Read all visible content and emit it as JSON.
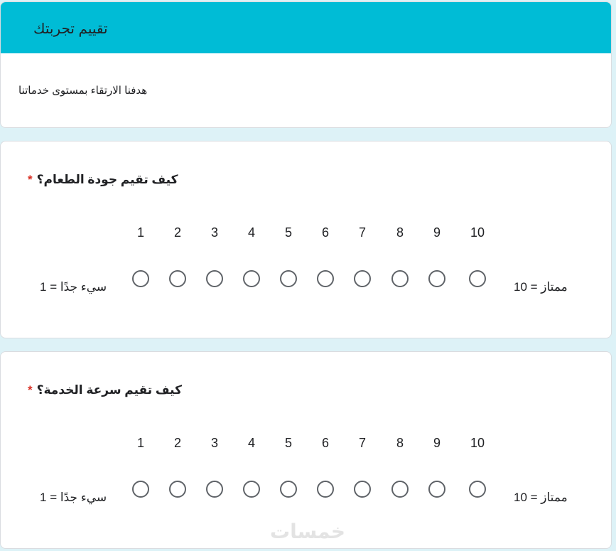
{
  "form": {
    "title": "تقييم تجربتك",
    "description": "هدفنا الارتقاء بمستوى خدماتنا",
    "header_color": "#00bcd6"
  },
  "questions": [
    {
      "title": "كيف تقيم جودة الطعام؟",
      "required_mark": "*",
      "scale": [
        "1",
        "2",
        "3",
        "4",
        "5",
        "6",
        "7",
        "8",
        "9",
        "10"
      ],
      "low_label": "سيء جدًا = 1",
      "high_label": "ممتاز = 10"
    },
    {
      "title": "كيف تقيم سرعة الخدمة؟",
      "required_mark": "*",
      "scale": [
        "1",
        "2",
        "3",
        "4",
        "5",
        "6",
        "7",
        "8",
        "9",
        "10"
      ],
      "low_label": "سيء جدًا = 1",
      "high_label": "ممتاز = 10"
    }
  ],
  "watermark": "خمسات"
}
